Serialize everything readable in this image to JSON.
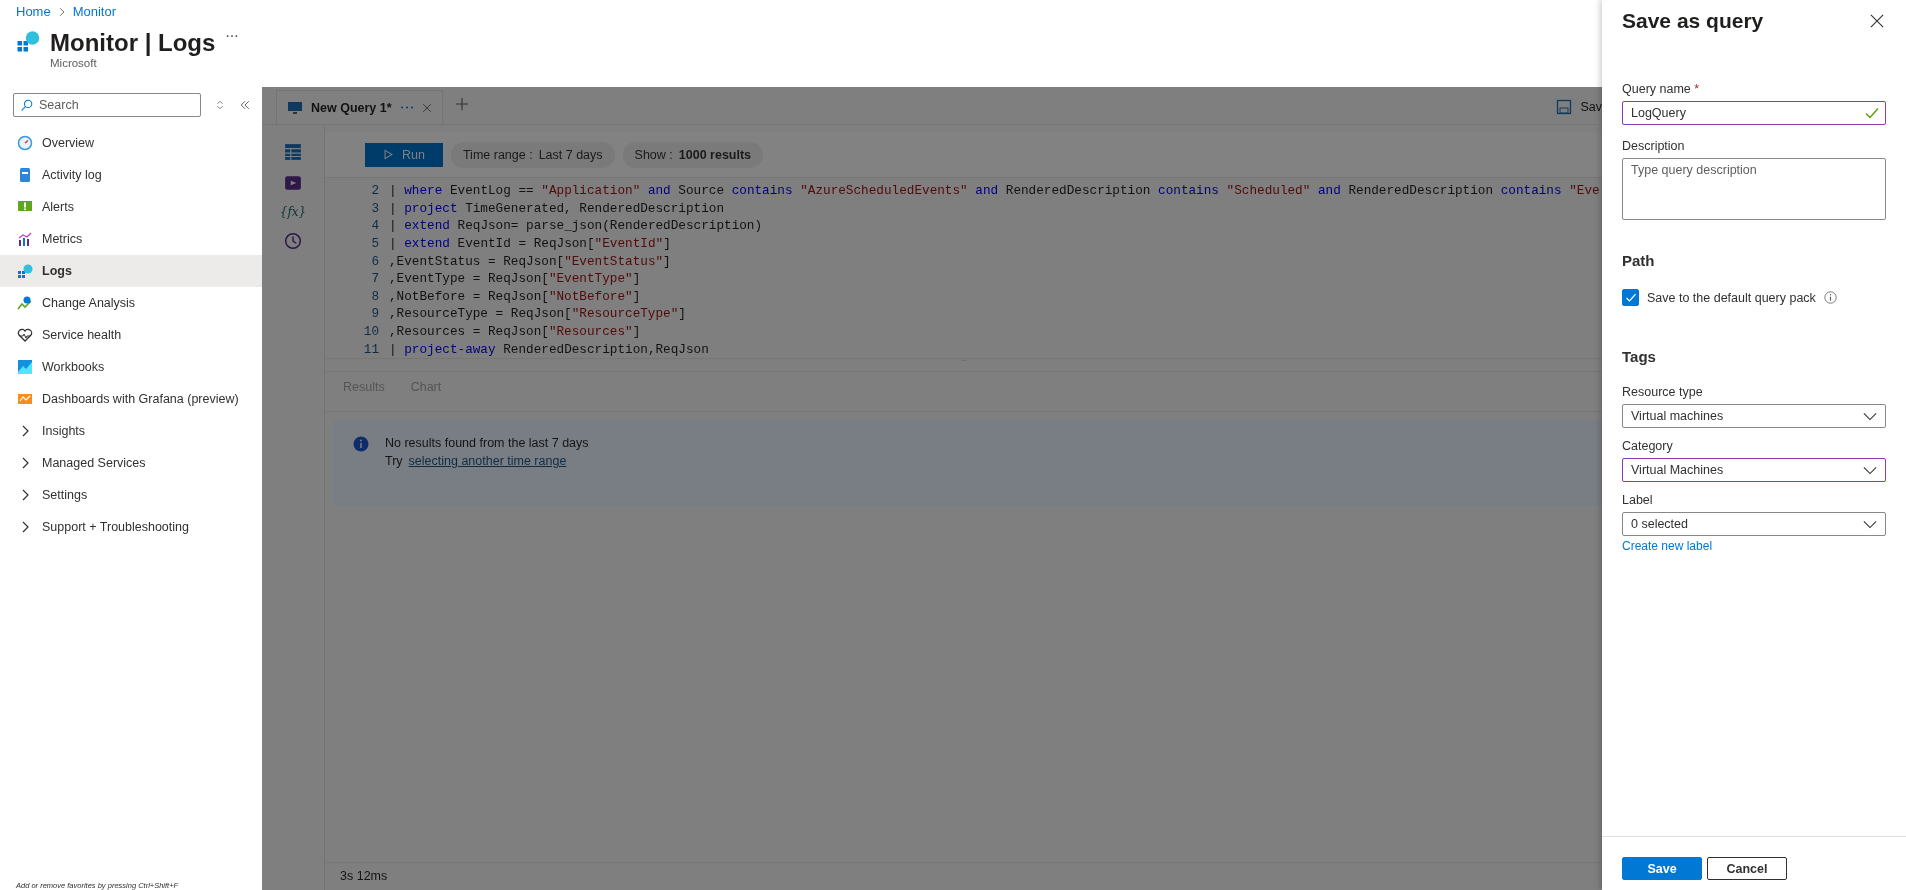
{
  "breadcrumb": [
    {
      "label": "Home"
    },
    {
      "label": "Monitor"
    }
  ],
  "header": {
    "title": "Monitor | Logs",
    "subtitle": "Microsoft"
  },
  "sidebar": {
    "search": {
      "placeholder": "Search"
    },
    "items": [
      {
        "label": "Overview",
        "kind": "link",
        "selected": false
      },
      {
        "label": "Activity log",
        "kind": "link",
        "selected": false
      },
      {
        "label": "Alerts",
        "kind": "link",
        "selected": false
      },
      {
        "label": "Metrics",
        "kind": "link",
        "selected": false
      },
      {
        "label": "Logs",
        "kind": "link",
        "selected": true
      },
      {
        "label": "Change Analysis",
        "kind": "link",
        "selected": false
      },
      {
        "label": "Service health",
        "kind": "link",
        "selected": false
      },
      {
        "label": "Workbooks",
        "kind": "link",
        "selected": false
      },
      {
        "label": "Dashboards with Grafana (preview)",
        "kind": "link",
        "selected": false
      },
      {
        "label": "Insights",
        "kind": "group",
        "selected": false
      },
      {
        "label": "Managed Services",
        "kind": "group",
        "selected": false
      },
      {
        "label": "Settings",
        "kind": "group",
        "selected": false
      },
      {
        "label": "Support + Troubleshooting",
        "kind": "group",
        "selected": false
      }
    ],
    "footer": "Add or remove favorites by pressing Ctrl+Shift+F"
  },
  "query_tabs": [
    {
      "label": "New Query 1*",
      "selected": true
    }
  ],
  "save_action": "Sav",
  "function_label": "{fx}",
  "toolbar": {
    "run": "Run",
    "time_range_label": "Time range :",
    "time_range_value": "Last 7 days",
    "show_label": "Show :",
    "show_value": "1000 results"
  },
  "editor": {
    "lines": [
      {
        "number": "2",
        "tokens": [
          {
            "kind": "text",
            "text": "| "
          },
          {
            "kind": "keyword",
            "text": "where"
          },
          {
            "kind": "text",
            "text": " EventLog == "
          },
          {
            "kind": "string",
            "text": "\"Application\" "
          },
          {
            "kind": "keyword",
            "text": "and"
          },
          {
            "kind": "text",
            "text": " Source "
          },
          {
            "kind": "keyword",
            "text": "contains"
          },
          {
            "kind": "string",
            "text": " \"AzureScheduledEvents\" "
          },
          {
            "kind": "keyword",
            "text": "and"
          },
          {
            "kind": "text",
            "text": " RenderedDescription "
          },
          {
            "kind": "keyword",
            "text": "contains"
          },
          {
            "kind": "string",
            "text": " \"Scheduled\" "
          },
          {
            "kind": "keyword",
            "text": "and"
          },
          {
            "kind": "text",
            "text": " RenderedDescription "
          },
          {
            "kind": "keyword",
            "text": "contains"
          },
          {
            "kind": "string",
            "text": " \"Eve"
          }
        ]
      },
      {
        "number": "3",
        "tokens": [
          {
            "kind": "text",
            "text": "| "
          },
          {
            "kind": "keyword",
            "text": "project"
          },
          {
            "kind": "text",
            "text": " TimeGenerated, RenderedDescription"
          }
        ]
      },
      {
        "number": "4",
        "tokens": [
          {
            "kind": "text",
            "text": "| "
          },
          {
            "kind": "keyword",
            "text": "extend"
          },
          {
            "kind": "text",
            "text": " ReqJson= parse_json(RenderedDescription)"
          }
        ]
      },
      {
        "number": "5",
        "tokens": [
          {
            "kind": "text",
            "text": "| "
          },
          {
            "kind": "keyword",
            "text": "extend"
          },
          {
            "kind": "text",
            "text": " EventId = ReqJson["
          },
          {
            "kind": "string",
            "text": "\"EventId\""
          },
          {
            "kind": "text",
            "text": "]"
          }
        ]
      },
      {
        "number": "6",
        "tokens": [
          {
            "kind": "text",
            "text": ",EventStatus = ReqJson["
          },
          {
            "kind": "string",
            "text": "\"EventStatus\""
          },
          {
            "kind": "text",
            "text": "]"
          }
        ]
      },
      {
        "number": "7",
        "tokens": [
          {
            "kind": "text",
            "text": ",EventType = ReqJson["
          },
          {
            "kind": "string",
            "text": "\"EventType\""
          },
          {
            "kind": "text",
            "text": "]"
          }
        ]
      },
      {
        "number": "8",
        "tokens": [
          {
            "kind": "text",
            "text": ",NotBefore = ReqJson["
          },
          {
            "kind": "string",
            "text": "\"NotBefore\""
          },
          {
            "kind": "text",
            "text": "]"
          }
        ]
      },
      {
        "number": "9",
        "tokens": [
          {
            "kind": "text",
            "text": ",ResourceType = ReqJson["
          },
          {
            "kind": "string",
            "text": "\"ResourceType\""
          },
          {
            "kind": "text",
            "text": "]"
          }
        ]
      },
      {
        "number": "10",
        "tokens": [
          {
            "kind": "text",
            "text": ",Resources = ReqJson["
          },
          {
            "kind": "string",
            "text": "\"Resources\""
          },
          {
            "kind": "text",
            "text": "]"
          }
        ]
      },
      {
        "number": "11",
        "tokens": [
          {
            "kind": "text",
            "text": "| "
          },
          {
            "kind": "keyword",
            "text": "project-away"
          },
          {
            "kind": "text",
            "text": " RenderedDescription,ReqJson"
          }
        ]
      }
    ]
  },
  "results": {
    "tabs": [
      {
        "label": "Results"
      },
      {
        "label": "Chart"
      }
    ],
    "message": "No results found from the last 7 days",
    "try_text": "Try",
    "link": "selecting another time range"
  },
  "status": "3s 12ms",
  "panel": {
    "title": "Save as query",
    "query_name": {
      "label": "Query name",
      "required_mark": "*",
      "value": "LogQuery",
      "valid": true
    },
    "description": {
      "label": "Description",
      "placeholder": "Type query description"
    },
    "path_heading": "Path",
    "default_pack": {
      "label": "Save to the default query pack",
      "checked": true
    },
    "tags_heading": "Tags",
    "selects": [
      {
        "label": "Resource type",
        "value": "Virtual machines",
        "focused": false
      },
      {
        "label": "Category",
        "value": "Virtual Machines",
        "focused": true
      },
      {
        "label": "Label",
        "value": "0 selected",
        "focused": false
      }
    ],
    "create_label_link": "Create new label",
    "buttons": [
      {
        "label": "Save",
        "kind": "primary"
      },
      {
        "label": "Cancel",
        "kind": "secondary"
      }
    ]
  }
}
